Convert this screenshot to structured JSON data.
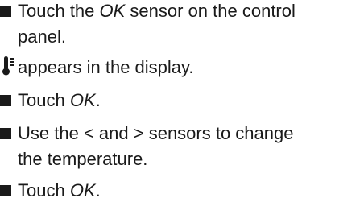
{
  "steps": [
    {
      "pre": "Touch the ",
      "em": "OK",
      "post": " sensor on the control",
      "cont": "panel."
    },
    {
      "result_text": "appears in the display.",
      "icon": "thermometer-icon"
    },
    {
      "pre": "Touch ",
      "em": "OK",
      "post": "."
    },
    {
      "pre": "Use the ",
      "lt": "<",
      "mid": " and ",
      "gt": ">",
      "post": " sensors to change",
      "cont": "the temperature."
    },
    {
      "pre": "Touch ",
      "em": "OK",
      "post": "."
    }
  ]
}
